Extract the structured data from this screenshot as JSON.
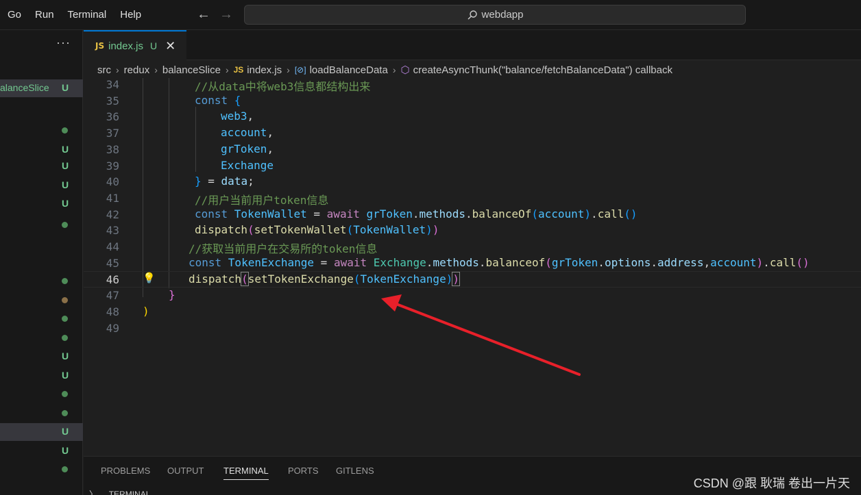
{
  "menu": [
    "Go",
    "Run",
    "Terminal",
    "Help"
  ],
  "search": {
    "text": "webdapp"
  },
  "sidebar": {
    "more_label": "···",
    "active_item_label": "alanceSlice",
    "active_item_marker": "U",
    "markers": [
      {
        "type": "dot",
        "color": "#4e8c58"
      },
      {
        "type": "U"
      },
      {
        "type": "U"
      },
      {
        "type": "U"
      },
      {
        "type": "U"
      },
      {
        "type": "dot",
        "color": "#4e8c58"
      },
      {
        "type": "dot",
        "color": "#4e8c58"
      },
      {
        "type": "dot",
        "color": "#8a7048"
      },
      {
        "type": "dot",
        "color": "#4e8c58"
      },
      {
        "type": "dot",
        "color": "#4e8c58"
      },
      {
        "type": "U"
      },
      {
        "type": "U"
      },
      {
        "type": "dot",
        "color": "#4e8c58"
      },
      {
        "type": "dot",
        "color": "#4e8c58"
      },
      {
        "type": "U",
        "selected": true
      },
      {
        "type": "U"
      },
      {
        "type": "dot",
        "color": "#4e8c58"
      }
    ]
  },
  "tab": {
    "badge": "JS",
    "name": "index.js",
    "status": "U",
    "close": "✕"
  },
  "breadcrumb": {
    "items": [
      "src",
      "redux",
      "balanceSlice",
      "index.js",
      "loadBalanceData",
      "createAsyncThunk(\"balance/fetchBalanceData\") callback"
    ],
    "js_badge": "JS"
  },
  "editor": {
    "lines": [
      {
        "n": "34",
        "segs": [
          [
            "c-com",
            "//从data中将web3信息都结构出来"
          ]
        ]
      },
      {
        "n": "35",
        "segs": [
          [
            "c-kw",
            "const "
          ],
          [
            "c-br3",
            "{"
          ]
        ]
      },
      {
        "n": "36",
        "segs": [
          [
            "c-var",
            "web3"
          ],
          [
            "c-plain",
            ","
          ]
        ]
      },
      {
        "n": "37",
        "segs": [
          [
            "c-var",
            "account"
          ],
          [
            "c-plain",
            ","
          ]
        ]
      },
      {
        "n": "38",
        "segs": [
          [
            "c-var",
            "grToken"
          ],
          [
            "c-plain",
            ","
          ]
        ]
      },
      {
        "n": "39",
        "segs": [
          [
            "c-var",
            "Exchange"
          ]
        ]
      },
      {
        "n": "40",
        "segs": [
          [
            "c-br3",
            "}"
          ],
          [
            "c-plain",
            " = "
          ],
          [
            "c-ident",
            "data"
          ],
          [
            "c-plain",
            ";"
          ]
        ]
      },
      {
        "n": "41",
        "segs": [
          [
            "c-com",
            "//用户当前用户token信息"
          ]
        ]
      },
      {
        "n": "42",
        "segs": [
          [
            "c-kw",
            "const "
          ],
          [
            "c-var",
            "TokenWallet"
          ],
          [
            "c-plain",
            " = "
          ],
          [
            "c-ctrl",
            "await "
          ],
          [
            "c-var",
            "grToken"
          ],
          [
            "c-plain",
            "."
          ],
          [
            "c-ident",
            "methods"
          ],
          [
            "c-plain",
            "."
          ],
          [
            "c-fn",
            "balanceOf"
          ],
          [
            "c-br3",
            "("
          ],
          [
            "c-var",
            "account"
          ],
          [
            "c-br3",
            ")"
          ],
          [
            "c-plain",
            "."
          ],
          [
            "c-fn",
            "call"
          ],
          [
            "c-br3",
            "()"
          ]
        ]
      },
      {
        "n": "43",
        "segs": [
          [
            "c-fn",
            "dispatch"
          ],
          [
            "c-br2",
            "("
          ],
          [
            "c-fn",
            "setTokenWallet"
          ],
          [
            "c-br3",
            "("
          ],
          [
            "c-var",
            "TokenWallet"
          ],
          [
            "c-br3",
            ")"
          ],
          [
            "c-br2",
            ")"
          ]
        ]
      },
      {
        "n": "44",
        "segs": [
          [
            "c-com",
            "//获取当前用户在交易所的token信息"
          ]
        ]
      },
      {
        "n": "45",
        "segs": [
          [
            "c-kw",
            "const "
          ],
          [
            "c-var",
            "TokenExchange"
          ],
          [
            "c-plain",
            " = "
          ],
          [
            "c-ctrl",
            "await "
          ],
          [
            "c-type",
            "Exchange"
          ],
          [
            "c-plain",
            "."
          ],
          [
            "c-ident",
            "methods"
          ],
          [
            "c-plain",
            "."
          ],
          [
            "c-fn",
            "balanceof"
          ],
          [
            "c-br2",
            "("
          ],
          [
            "c-var",
            "grToken"
          ],
          [
            "c-plain",
            "."
          ],
          [
            "c-ident",
            "options"
          ],
          [
            "c-plain",
            "."
          ],
          [
            "c-ident",
            "address"
          ],
          [
            "c-plain",
            ","
          ],
          [
            "c-var",
            "account"
          ],
          [
            "c-br2",
            ")"
          ],
          [
            "c-plain",
            "."
          ],
          [
            "c-fn",
            "call"
          ],
          [
            "c-br2",
            "()"
          ]
        ]
      },
      {
        "n": "46",
        "segs": [
          [
            "c-fn",
            "dispatch"
          ],
          [
            "c-br2 match",
            "("
          ],
          [
            "c-fn",
            "setTokenExchange"
          ],
          [
            "c-br3",
            "("
          ],
          [
            "c-var",
            "TokenExchange"
          ],
          [
            "c-br3",
            ")"
          ],
          [
            "c-br2 match",
            ")"
          ]
        ]
      },
      {
        "n": "47",
        "segs": [
          [
            "c-br2",
            "}"
          ]
        ]
      },
      {
        "n": "48",
        "segs": [
          [
            "c-br1",
            ")"
          ]
        ]
      },
      {
        "n": "49",
        "segs": []
      }
    ]
  },
  "panel": {
    "tabs": [
      "PROBLEMS",
      "OUTPUT",
      "TERMINAL",
      "PORTS",
      "GITLENS"
    ],
    "active": "TERMINAL",
    "sub": "〉 ⌄ TERMINAL"
  },
  "watermark": "CSDN @跟 耿瑞 卷出一片天",
  "colors": {
    "accent": "#0078d4",
    "annotation_arrow": "#e8202a",
    "git_untracked": "#73c991"
  }
}
